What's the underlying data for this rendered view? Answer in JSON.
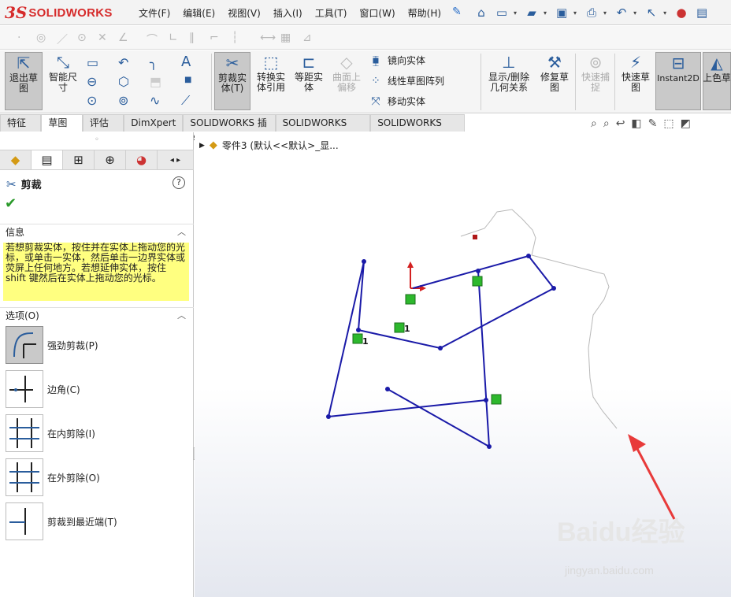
{
  "app": {
    "logo_prefix": "3S",
    "logo_text": "SOLIDWORKS"
  },
  "menu": [
    "文件(F)",
    "编辑(E)",
    "视图(V)",
    "插入(I)",
    "工具(T)",
    "窗口(W)",
    "帮助(H)"
  ],
  "ribbon": {
    "exit_sketch": "退出草图",
    "smart_dim": "智能尺寸",
    "trim": "剪裁实体(T)",
    "convert": "转换实体引用",
    "offset": "等距实体",
    "surface_offset": "曲面上偏移",
    "mirror": "镜向实体",
    "linear_pattern": "线性草图阵列",
    "move": "移动实体",
    "display_relations": "显示/删除几何关系",
    "repair": "修复草图",
    "quick_snap": "快速捕捉",
    "rapid_sketch": "快速草图",
    "instant2d": "Instant2D",
    "shaded": "上色草图轮廓"
  },
  "tabs": [
    "特征",
    "草图",
    "评估",
    "DimXpert",
    "SOLIDWORKS 插件",
    "SOLIDWORKS MBD",
    "SOLIDWORKS CAM"
  ],
  "active_tab": "草图",
  "panel": {
    "title": "剪裁",
    "info_header": "信息",
    "info_text": "若想剪裁实体，按住并在实体上拖动您的光标，或单击一实体，然后单击一边界实体或荧屏上任何地方。若想延伸实体，按住 shift 键然后在实体上拖动您的光标。",
    "options_header": "选项(O)",
    "options": [
      "强劲剪裁(P)",
      "边角(C)",
      "在内剪除(I)",
      "在外剪除(O)",
      "剪裁到最近端(T)"
    ]
  },
  "tree": {
    "part_label": "零件3 (默认<<默认>_显..."
  },
  "sketch_labels": {
    "rel1": "1",
    "rel2": "1"
  },
  "watermark": {
    "main": "Baidu经验",
    "sub": "jingyan.baidu.com"
  },
  "colors": {
    "sketch_line": "#1a1aa8",
    "relation_box": "#2db82d",
    "arrow": "#e83a3a"
  }
}
